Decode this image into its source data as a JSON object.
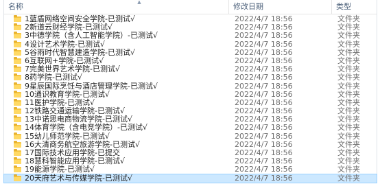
{
  "header": {
    "name_label": "名称",
    "date_label": "修改日期",
    "type_label": "类型",
    "sort_indicator": "▲"
  },
  "rows": [
    {
      "name": "1蓝盾网络空间安全学院-已测试√",
      "date": "2022/4/7 18:56",
      "type": "文件夹"
    },
    {
      "name": "2新道云财经学院-已测试√",
      "date": "2022/4/7 18:56",
      "type": "文件夹"
    },
    {
      "name": "3中德学院（含人工智能学院）-已测试√",
      "date": "2022/4/7 18:56",
      "type": "文件夹"
    },
    {
      "name": "4设计艺术学院-已测试√",
      "date": "2022/4/7 18:56",
      "type": "文件夹"
    },
    {
      "name": "5谷雨时代智慧建造学院-已测试√",
      "date": "2022/4/7 18:56",
      "type": "文件夹"
    },
    {
      "name": "6互联网+学院-已测试√",
      "date": "2022/4/7 18:56",
      "type": "文件夹"
    },
    {
      "name": "7完美世界艺术学院-已测试√",
      "date": "2022/4/7 18:56",
      "type": "文件夹"
    },
    {
      "name": "8药学院-已测试√",
      "date": "2022/4/7 18:56",
      "type": "文件夹"
    },
    {
      "name": "9星辰国际烹饪与酒店管理学院-已测试√",
      "date": "2022/4/7 18:56",
      "type": "文件夹"
    },
    {
      "name": "10通识教育学院-已测试√",
      "date": "2022/4/7 18:56",
      "type": "文件夹"
    },
    {
      "name": "11医护学院-已测试√",
      "date": "2022/4/7 18:56",
      "type": "文件夹"
    },
    {
      "name": "12铁路交通运输学院-已测试√",
      "date": "2022/4/7 18:56",
      "type": "文件夹"
    },
    {
      "name": "13中诺思电商物流学院-已测试√",
      "date": "2022/4/7 18:56",
      "type": "文件夹"
    },
    {
      "name": "14体育学院（含电竞学院）-已测试√",
      "date": "2022/4/7 18:56",
      "type": "文件夹"
    },
    {
      "name": "15幼儿师范学院-已测试√",
      "date": "2022/4/7 18:56",
      "type": "文件夹"
    },
    {
      "name": "16大清商务航空旅游学院-已测试√",
      "date": "2022/4/7 18:56",
      "type": "文件夹"
    },
    {
      "name": "17国际技术应用学院-已提交",
      "date": "2022/4/7 18:56",
      "type": "文件夹"
    },
    {
      "name": "18慧科智能应用学院-已测试√",
      "date": "2022/4/7 18:56",
      "type": "文件夹"
    },
    {
      "name": "19能源学院-已测试√",
      "date": "2022/4/7 18:56",
      "type": "文件夹"
    },
    {
      "name": "20天府艺术与传媒学院-已测试√",
      "date": "2022/4/7 18:56",
      "type": "文件夹"
    }
  ],
  "selected_index": 19
}
